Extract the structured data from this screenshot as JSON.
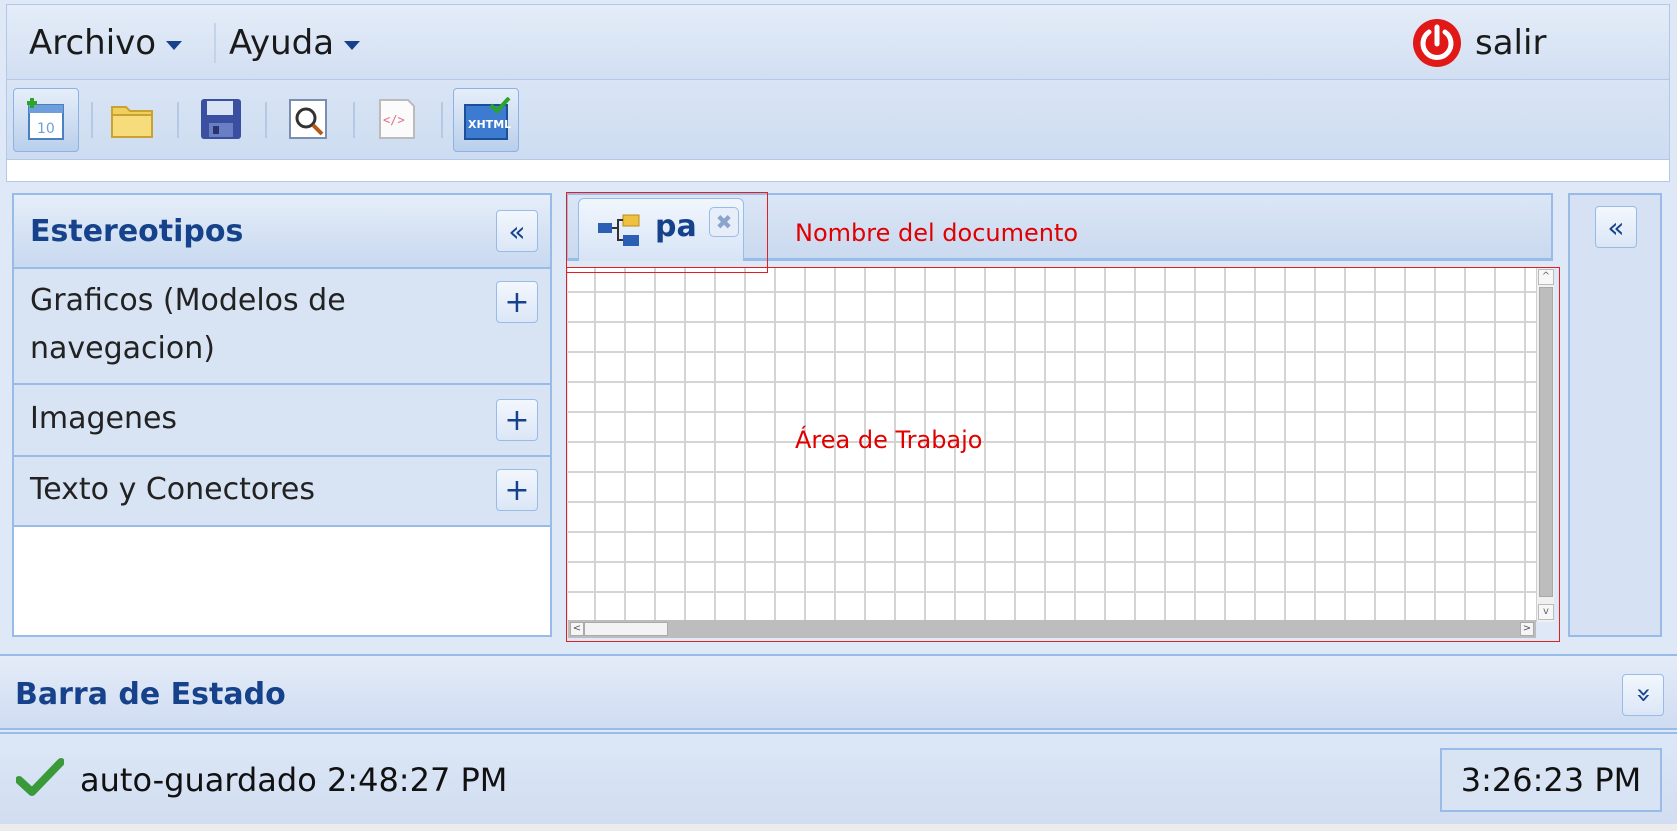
{
  "menubar": {
    "file_label": "Archivo",
    "help_label": "Ayuda",
    "exit_label": "salir",
    "exit_color": "#e01818"
  },
  "toolbar": {
    "buttons": [
      {
        "icon": "new-document-icon",
        "active": true
      },
      {
        "icon": "open-folder-icon",
        "active": false
      },
      {
        "icon": "save-disk-icon",
        "active": false
      },
      {
        "icon": "preview-magnifier-icon",
        "active": false
      },
      {
        "icon": "html-code-icon",
        "active": false
      },
      {
        "icon": "xhtml-validate-icon",
        "active": true
      }
    ]
  },
  "left_panel": {
    "title": "Estereotipos",
    "sections": [
      {
        "label_line1": "Graficos (Modelos de",
        "label_line2": "navegacion)"
      },
      {
        "label": "Imagenes"
      },
      {
        "label": "Texto y Conectores"
      }
    ]
  },
  "document": {
    "tab_label": "pa",
    "annotation_name": "Nombre del documento",
    "annotation_work": "Área de Trabajo"
  },
  "status": {
    "title": "Barra de Estado",
    "autosave_text": "auto-guardado 2:48:27 PM",
    "clock": "3:26:23 PM"
  },
  "colors": {
    "accent": "#15428b",
    "border": "#99bbe8",
    "annotation": "#e00000"
  }
}
